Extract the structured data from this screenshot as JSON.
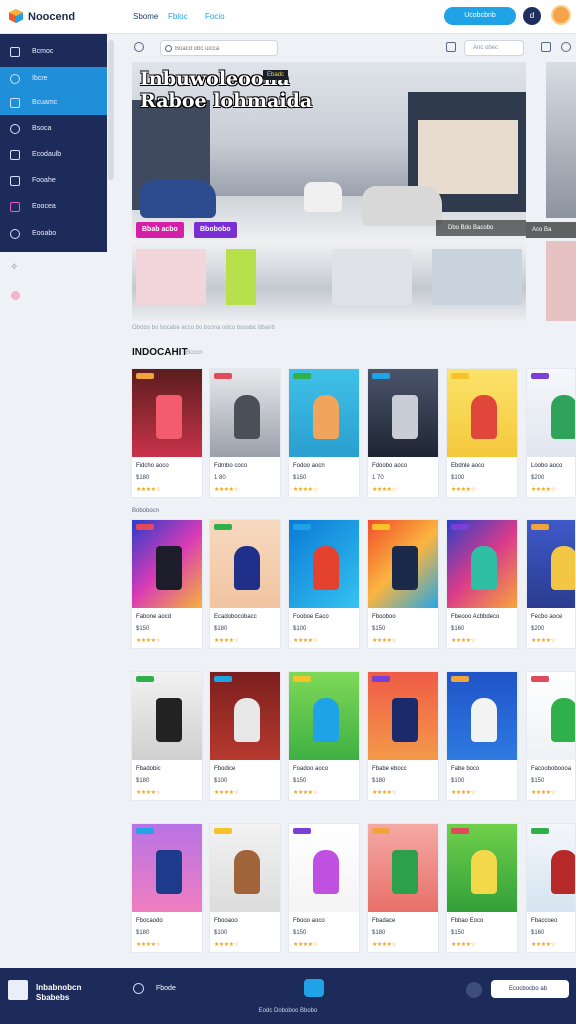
{
  "app": {
    "title": "Noocend"
  },
  "header": {
    "links": [
      "Sbome",
      "Fbloc",
      "Focio"
    ],
    "cta": "Ucobcbnb",
    "icon_label": "d"
  },
  "sidebar": {
    "items": [
      {
        "label": "Bcmoc",
        "icon": "arrows-icon",
        "active": false
      },
      {
        "label": "Ibcre",
        "icon": "circle-icon",
        "active": true
      },
      {
        "label": "Bcuamc",
        "icon": "monitor-icon",
        "active": true
      },
      {
        "label": "Bsoca",
        "icon": "eye-icon",
        "active": false
      },
      {
        "label": "Ecodaulb",
        "icon": "cart-icon",
        "active": false
      },
      {
        "label": "Fooahe",
        "icon": "calendar-icon",
        "active": false
      },
      {
        "label": "Eoocea",
        "icon": "camera-icon",
        "active": false
      },
      {
        "label": "Eooabo",
        "icon": "gear-icon",
        "active": false
      }
    ]
  },
  "toolbar": {
    "search_placeholder": "Boacd obc uicca",
    "select_value": "Anc obec"
  },
  "hero": {
    "title_line1": "Inbuwoleoona",
    "title_line2": "Raboe lohmaida",
    "tag": "Ebadc",
    "chips": [
      "Bbab acbo",
      "Bbobobo"
    ],
    "bar_text": "Dbo Bdo Bacobo",
    "side_bar_text": "Aco Ba"
  },
  "caption": "Obobo bo bocabe acco bo bcona odco booabc bbanb",
  "section": {
    "title": "INDOCAHIT",
    "subtitle": "Bcocn",
    "label": "Bobobocn"
  },
  "products": [
    {
      "name": "Fidcho aoco",
      "price": "$180",
      "rating": 4
    },
    {
      "name": "Fdmbo coco",
      "price": "1 80",
      "rating": 4
    },
    {
      "name": "Fodoo aocn",
      "price": "$150",
      "rating": 4
    },
    {
      "name": "Fdoobo aoco",
      "price": "1 70",
      "rating": 4
    },
    {
      "name": "Ebdnle aoco",
      "price": "$100",
      "rating": 4
    },
    {
      "name": "Loobo aoco",
      "price": "$200",
      "rating": 4
    },
    {
      "name": "Fabone aocd",
      "price": "$150",
      "rating": 4
    },
    {
      "name": "Ecadobocobacc",
      "price": "$180",
      "rating": 4
    },
    {
      "name": "Fooboe Eaco",
      "price": "$100",
      "rating": 4
    },
    {
      "name": "Fbooboo",
      "price": "$150",
      "rating": 4
    },
    {
      "name": "Fbeooo Acbbdeco",
      "price": "$160",
      "rating": 4
    },
    {
      "name": "Fecbo aoce",
      "price": "$200",
      "rating": 4
    },
    {
      "name": "Fbadobic",
      "price": "$180",
      "rating": 4
    },
    {
      "name": "Fbodice",
      "price": "$100",
      "rating": 4
    },
    {
      "name": "Foadoo aoco",
      "price": "$150",
      "rating": 4
    },
    {
      "name": "Fbabe ebocc",
      "price": "$180",
      "rating": 4
    },
    {
      "name": "Fabe boco",
      "price": "$100",
      "rating": 4
    },
    {
      "name": "Facooboboooa",
      "price": "$150",
      "rating": 4
    },
    {
      "name": "Fbocaodo",
      "price": "$180",
      "rating": 4
    },
    {
      "name": "Fbooaoo",
      "price": "$100",
      "rating": 4
    },
    {
      "name": "Fbooo aoco",
      "price": "$150",
      "rating": 4
    },
    {
      "name": "Fbadace",
      "price": "$180",
      "rating": 4
    },
    {
      "name": "Fbbao Eoco",
      "price": "$150",
      "rating": 4
    },
    {
      "name": "Fbaccoeo",
      "price": "$160",
      "rating": 4
    }
  ],
  "footer": {
    "brand_line1": "Inbabnobcn",
    "brand_line2": "Sbabebs",
    "link": "Fbode",
    "cta": "Ecocbocbo ab",
    "bottom": "Eodc Doboboo Bbobo"
  },
  "colors": {
    "navy": "#1c2b5a",
    "accent": "#1fa3e6",
    "star": "#f2a413"
  }
}
